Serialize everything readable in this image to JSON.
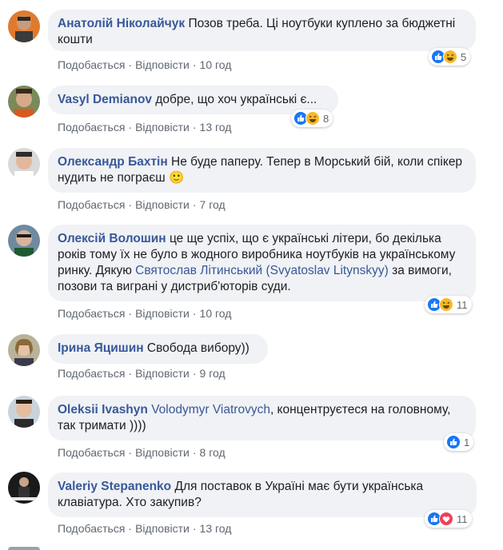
{
  "labels": {
    "like": "Подобається",
    "reply": "Відповісти",
    "sep": "·"
  },
  "comments": [
    {
      "author": "Анатолій Ніколайчук",
      "text": "Позов треба. Ці ноутбуки куплено за бюджетні кошти",
      "time": "10 год",
      "reaction_count": "5"
    },
    {
      "author": "Vasyl Demianov",
      "text": "добре, що хоч українські є...",
      "time": "13 год",
      "reaction_count": "8"
    },
    {
      "author": "Олександр Бахтін",
      "text": "Не буде паперу. Тепер в Морський бій, коли спікер нудить не пограєш 🙂",
      "time": "7 год",
      "reaction_count": ""
    },
    {
      "author": "Олексій Волошин",
      "text_before": "це ще успіх, що є українські літери, бо декілька років тому їх не було в жодного виробника ноутбуків на українському ринку. Дякую ",
      "mention": "Святослав Літинський (Svyatoslav Litynskyy)",
      "text_after": " за вимоги, позови та виграні у дистриб'юторів суди.",
      "time": "10 год",
      "reaction_count": "11"
    },
    {
      "author": "Ірина Яцишин",
      "text": "Свобода вибору))",
      "time": "9 год",
      "reaction_count": ""
    },
    {
      "author": "Oleksii Ivashyn",
      "mention": "Volodymyr Viatrovych",
      "text_after": ", концентруєтеся на головному, так тримати ))))",
      "time": "8 год",
      "reaction_count": "1"
    },
    {
      "author": "Valeriy Stepanenko",
      "text": "Для поставок в Україні має бути українська клавіатура. Хто закупив?",
      "time": "13 год",
      "reaction_count": "11"
    }
  ],
  "icons": {
    "like": "like-icon",
    "haha": "haha-icon",
    "love": "love-icon"
  },
  "colors": {
    "author": "#385898",
    "bubble": "#f0f2f5",
    "like": "#1877f2",
    "haha": "#f7b928",
    "love": "#f33e58"
  }
}
